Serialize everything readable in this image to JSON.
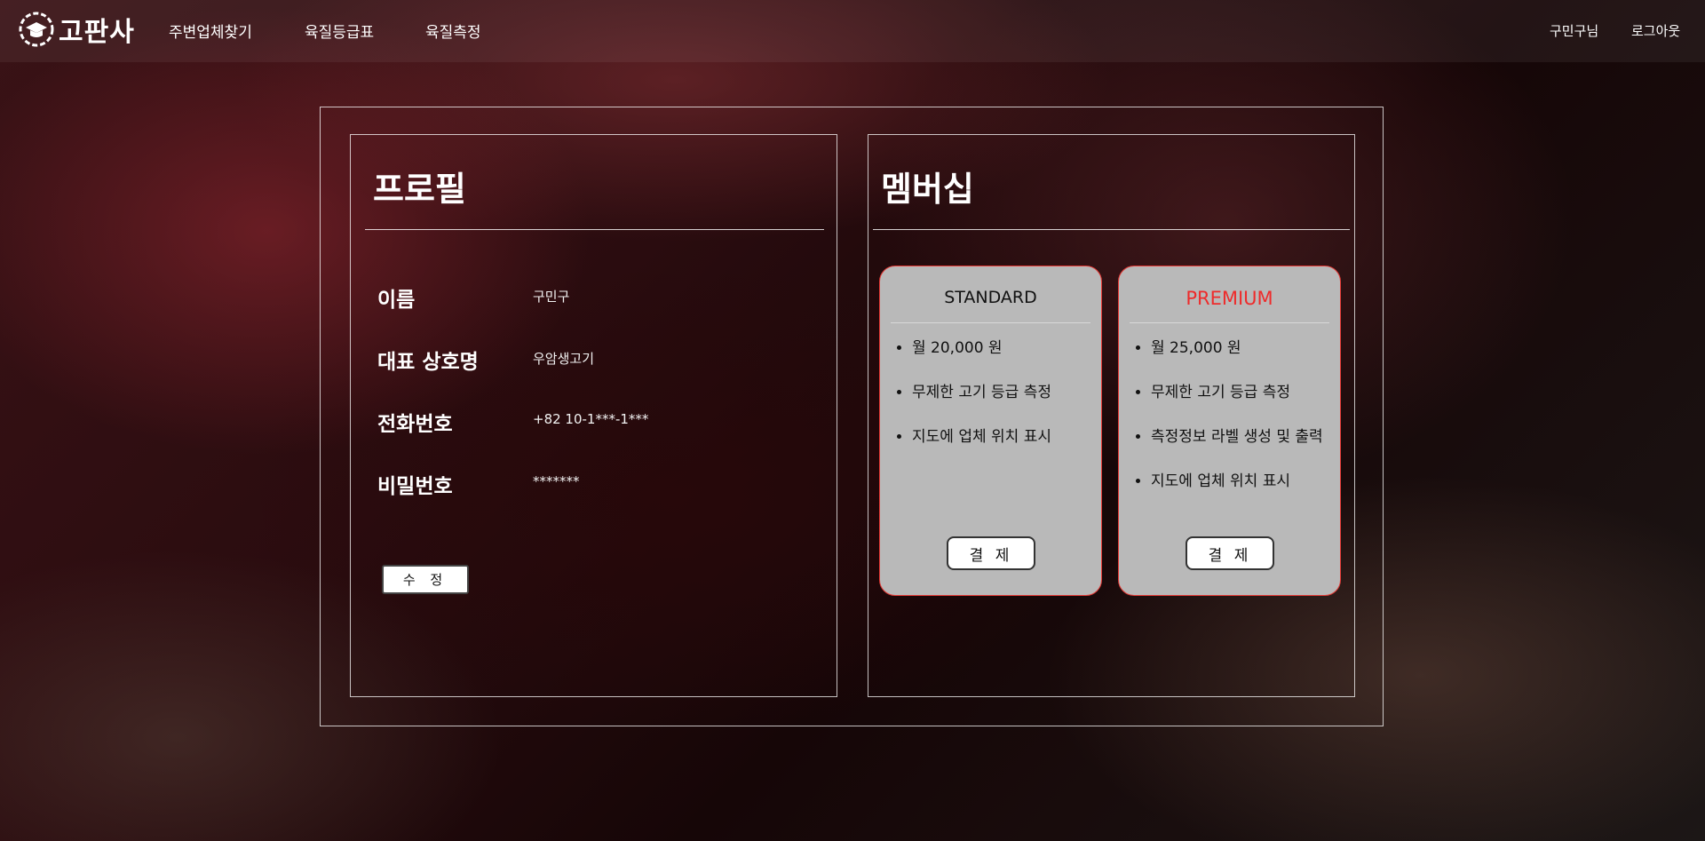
{
  "nav": {
    "logo_text": "고판사",
    "links": [
      "주변업체찾기",
      "육질등급표",
      "육질측정"
    ],
    "user_greeting": "구민구님",
    "logout_label": "로그아웃"
  },
  "profile": {
    "title": "프로필",
    "fields": [
      {
        "label": "이름",
        "value": "구민구"
      },
      {
        "label": "대표 상호명",
        "value": "우암생고기"
      },
      {
        "label": "전화번호",
        "value": "+82 10-1***-1***"
      },
      {
        "label": "비밀번호",
        "value": "*******"
      }
    ],
    "edit_label": "수 정"
  },
  "membership": {
    "title": "멤버십",
    "plans": [
      {
        "name": "STANDARD",
        "features": [
          "월 20,000 원",
          "무제한 고기 등급 측정",
          "지도에 업체 위치 표시"
        ],
        "pay_label": "결 제"
      },
      {
        "name": "PREMIUM",
        "features": [
          "월 25,000 원",
          "무제한 고기 등급 측정",
          "측정정보 라벨 생성 및 출력",
          "지도에 업체 위치 표시"
        ],
        "pay_label": "결 제"
      }
    ]
  },
  "colors": {
    "accent_red": "#e53935",
    "plan_card_bg": "#b9b9b9",
    "premium_text": "#ee2b2b"
  }
}
